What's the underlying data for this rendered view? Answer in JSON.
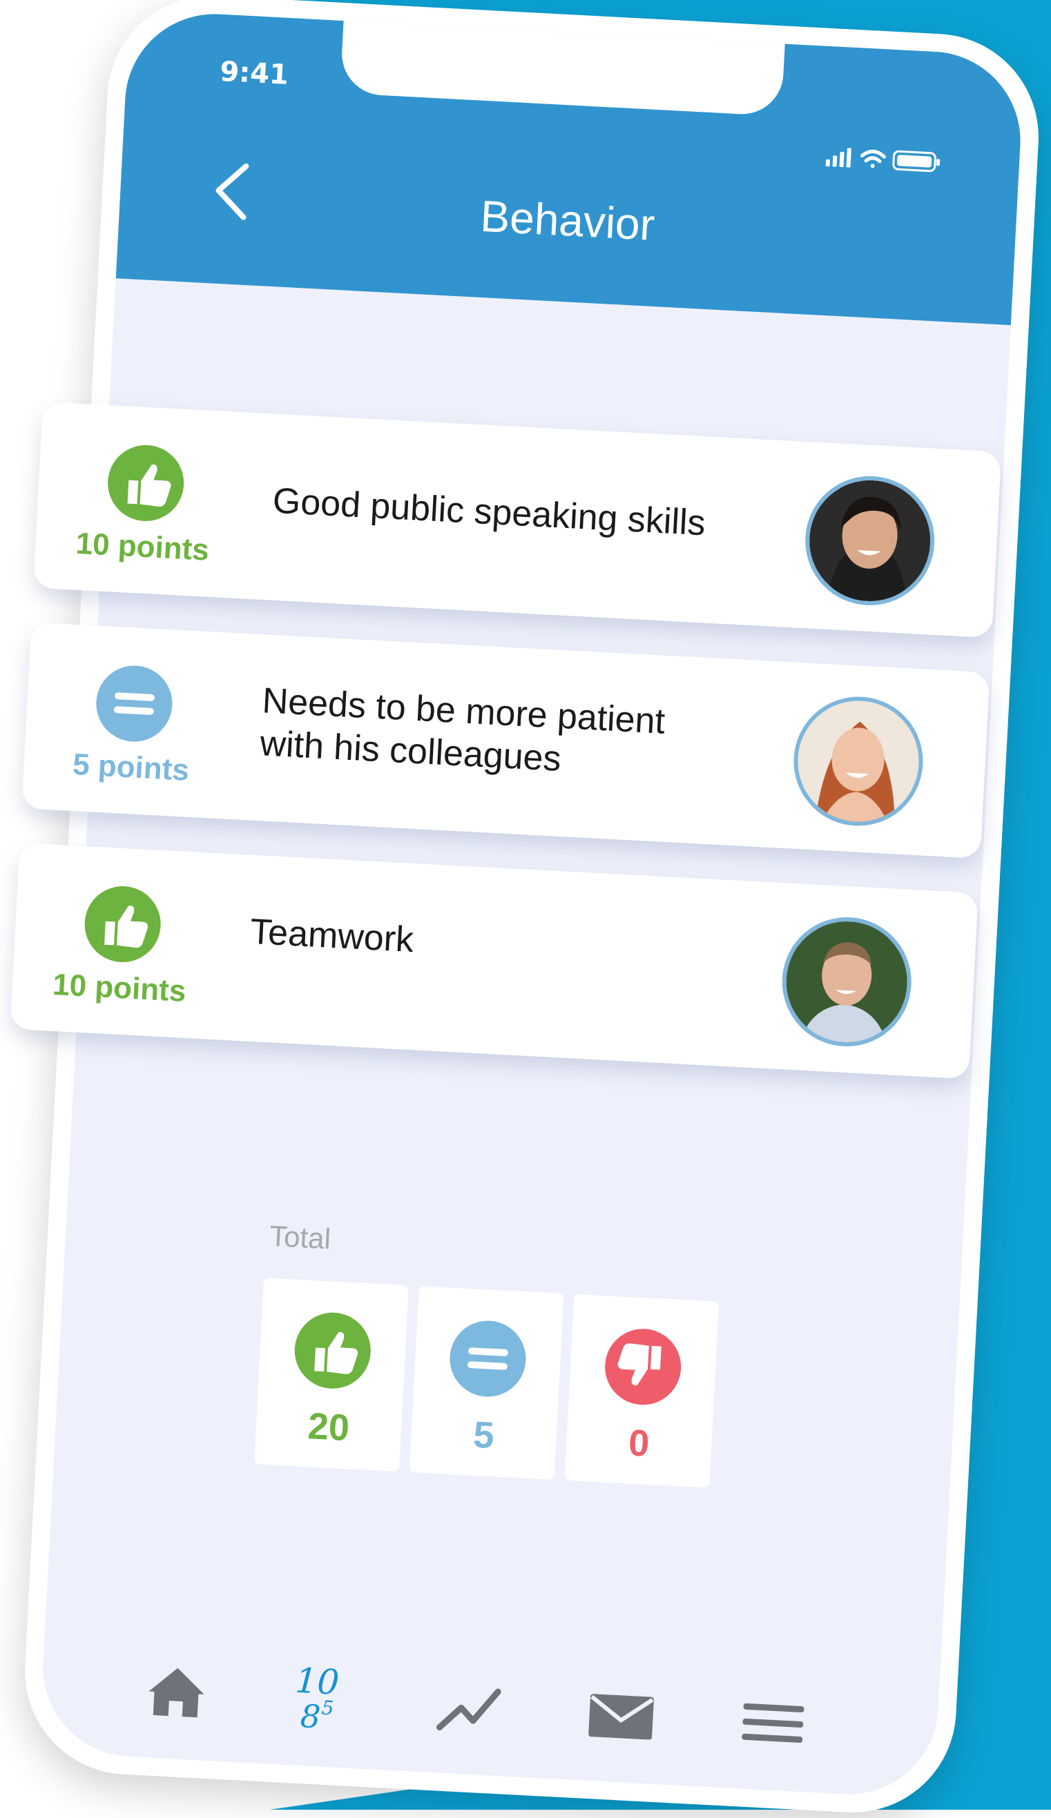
{
  "status_bar": {
    "time": "9:41"
  },
  "header": {
    "title": "Behavior"
  },
  "cards": [
    {
      "kind": "positive",
      "icon": "thumbs-up-icon",
      "points": "10 points",
      "text": "Good public speaking skills",
      "color": "#6db33f"
    },
    {
      "kind": "neutral",
      "icon": "equals-icon",
      "points": "5 points",
      "text": "Needs to be more patient with his colleagues",
      "color": "#7db8de"
    },
    {
      "kind": "positive",
      "icon": "thumbs-up-icon",
      "points": "10 points",
      "text": "Teamwork",
      "color": "#6db33f"
    }
  ],
  "totals": {
    "label": "Total",
    "items": [
      {
        "icon": "thumbs-up-icon",
        "value": "20",
        "color": "#6db33f"
      },
      {
        "icon": "equals-icon",
        "value": "5",
        "color": "#7db8de"
      },
      {
        "icon": "thumbs-down-icon",
        "value": "0",
        "color": "#ef5d6a"
      }
    ]
  },
  "tabbar": {
    "items": [
      {
        "name": "home",
        "icon": "home-icon"
      },
      {
        "name": "scores",
        "icon": "scores-icon",
        "glyph_top": "10",
        "glyph_bottom": "8",
        "glyph_sup": "5"
      },
      {
        "name": "progress",
        "icon": "trend-icon"
      },
      {
        "name": "messages",
        "icon": "mail-icon"
      },
      {
        "name": "menu",
        "icon": "hamburger-icon"
      }
    ]
  },
  "colors": {
    "header": "#3194cf",
    "background_band": "#0ba2d3",
    "screen_bg": "#eef1fb"
  }
}
